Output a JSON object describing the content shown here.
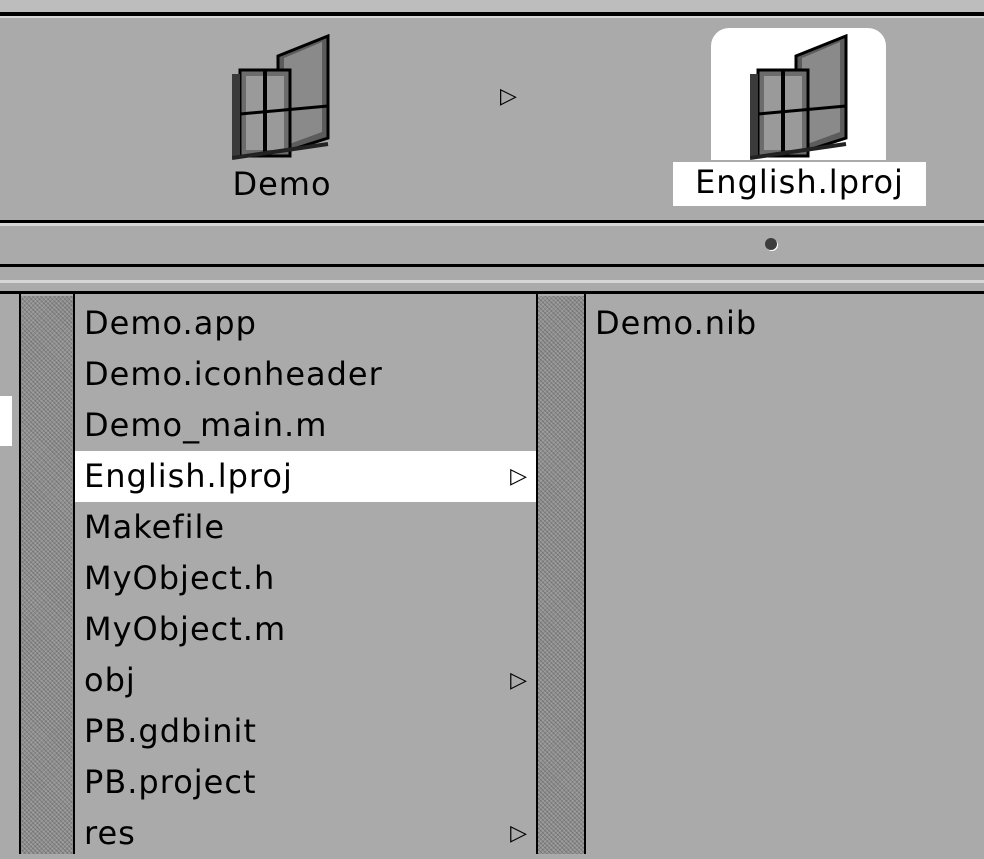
{
  "shelf": {
    "items": [
      {
        "label": "Demo",
        "icon": "folder-icon",
        "selected": false
      },
      {
        "label": "English.lproj",
        "icon": "folder-icon",
        "selected": true
      }
    ],
    "separator_arrow": "▷"
  },
  "scroller": {
    "indicator": "•"
  },
  "browser": {
    "columns": [
      {
        "items": [
          {
            "label": "Demo.app",
            "has_children": false,
            "selected": false
          },
          {
            "label": "Demo.iconheader",
            "has_children": false,
            "selected": false
          },
          {
            "label": "Demo_main.m",
            "has_children": false,
            "selected": false
          },
          {
            "label": "English.lproj",
            "has_children": true,
            "selected": true
          },
          {
            "label": "Makefile",
            "has_children": false,
            "selected": false
          },
          {
            "label": "MyObject.h",
            "has_children": false,
            "selected": false
          },
          {
            "label": "MyObject.m",
            "has_children": false,
            "selected": false
          },
          {
            "label": "obj",
            "has_children": true,
            "selected": false
          },
          {
            "label": "PB.gdbinit",
            "has_children": false,
            "selected": false
          },
          {
            "label": "PB.project",
            "has_children": false,
            "selected": false
          },
          {
            "label": "res",
            "has_children": true,
            "selected": false
          }
        ]
      },
      {
        "items": [
          {
            "label": "Demo.nib",
            "has_children": false,
            "selected": false
          }
        ]
      }
    ],
    "branch_arrow": "▷"
  },
  "colors": {
    "background": "#aaaaaa",
    "selection": "#ffffff",
    "stripe": "#8e8e8e"
  }
}
